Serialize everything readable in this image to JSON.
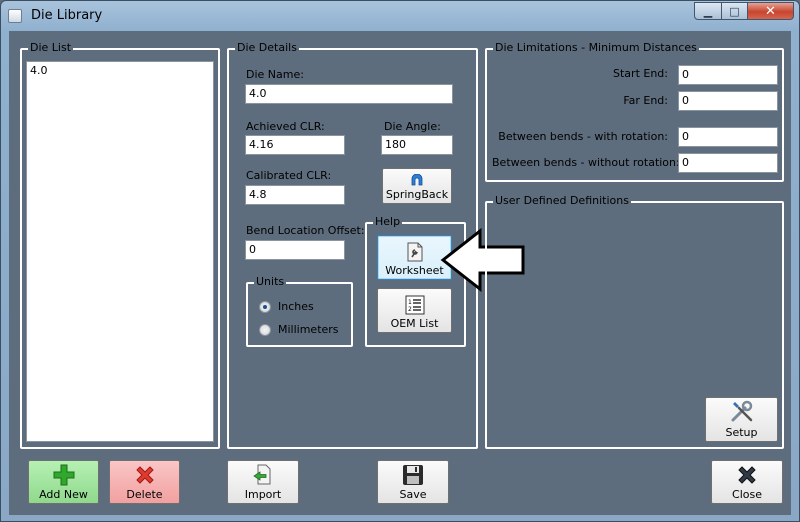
{
  "window": {
    "title": "Die Library",
    "min": "▁",
    "max": "□",
    "close": "✕"
  },
  "die_list": {
    "title": "Die List",
    "items": [
      "4.0"
    ]
  },
  "die_details": {
    "title": "Die Details",
    "die_name_label": "Die Name:",
    "die_name_value": "4.0",
    "achieved_clr_label": "Achieved CLR:",
    "achieved_clr_value": "4.16",
    "die_angle_label": "Die Angle:",
    "die_angle_value": "180",
    "calibrated_clr_label": "Calibrated CLR:",
    "calibrated_clr_value": "4.8",
    "springback_label": "SpringBack",
    "bend_offset_label": "Bend Location Offset:",
    "bend_offset_value": "0",
    "units": {
      "title": "Units",
      "inches": "Inches",
      "millimeters": "Millimeters",
      "selected": "Inches"
    },
    "help": {
      "title": "Help",
      "worksheet_label": "Worksheet",
      "oem_list_label": "OEM List"
    }
  },
  "limitations": {
    "title": "Die Limitations - Minimum Distances",
    "start_end_label": "Start End:",
    "start_end_value": "0",
    "far_end_label": "Far End:",
    "far_end_value": "0",
    "with_rotation_label": "Between bends - with rotation:",
    "with_rotation_value": "0",
    "without_rotation_label": "Between bends - without rotation:",
    "without_rotation_value": "0"
  },
  "user_defined": {
    "title": "User Defined Definitions",
    "setup_label": "Setup"
  },
  "bottom_buttons": {
    "add_new": "Add New",
    "delete": "Delete",
    "import": "Import",
    "save": "Save",
    "close": "Close"
  }
}
